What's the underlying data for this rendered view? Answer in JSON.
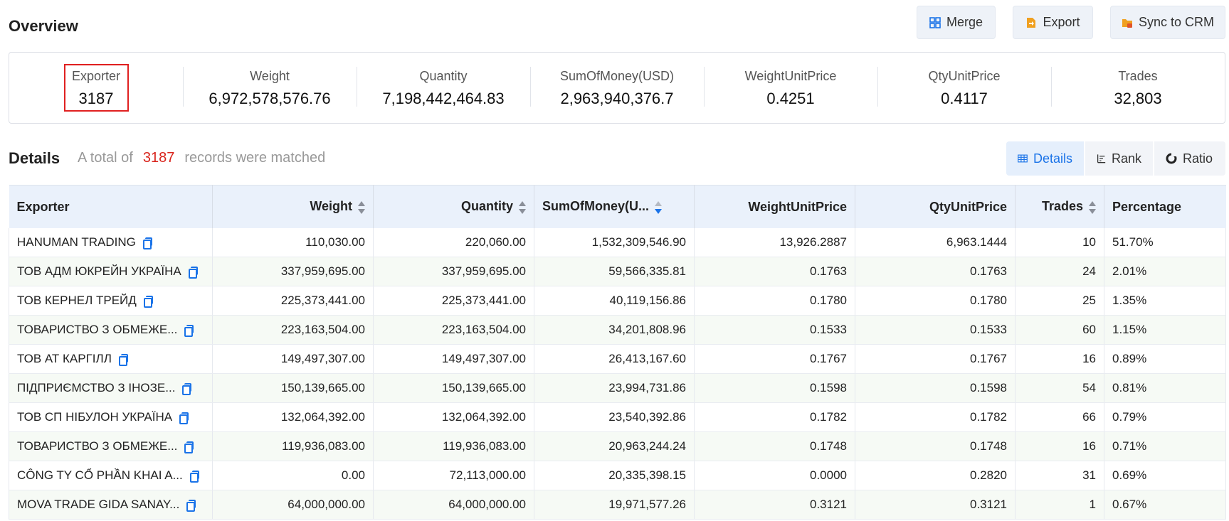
{
  "overview": {
    "title": "Overview",
    "actions": [
      {
        "label": "Merge",
        "icon": "merge-icon"
      },
      {
        "label": "Export",
        "icon": "export-icon"
      },
      {
        "label": "Sync to CRM",
        "icon": "folder-icon"
      }
    ],
    "stats": [
      {
        "label": "Exporter",
        "value": "3187"
      },
      {
        "label": "Weight",
        "value": "6,972,578,576.76"
      },
      {
        "label": "Quantity",
        "value": "7,198,442,464.83"
      },
      {
        "label": "SumOfMoney(USD)",
        "value": "2,963,940,376.7"
      },
      {
        "label": "WeightUnitPrice",
        "value": "0.4251"
      },
      {
        "label": "QtyUnitPrice",
        "value": "0.4117"
      },
      {
        "label": "Trades",
        "value": "32,803"
      }
    ]
  },
  "details": {
    "title": "Details",
    "summary_prefix": "A total of",
    "summary_count": "3187",
    "summary_suffix": "records were matched",
    "views": [
      {
        "label": "Details",
        "icon": "table-icon",
        "active": true
      },
      {
        "label": "Rank",
        "icon": "rank-icon",
        "active": false
      },
      {
        "label": "Ratio",
        "icon": "pie-icon",
        "active": false
      }
    ],
    "columns": [
      "Exporter",
      "Weight",
      "Quantity",
      "SumOfMoney(U...",
      "WeightUnitPrice",
      "QtyUnitPrice",
      "Trades",
      "Percentage"
    ],
    "rows": [
      [
        "HANUMAN TRADING",
        "110,030.00",
        "220,060.00",
        "1,532,309,546.90",
        "13,926.2887",
        "6,963.1444",
        "10",
        "51.70%"
      ],
      [
        "ТОВ АДМ ЮКРЕЙН УКРАЇНА",
        "337,959,695.00",
        "337,959,695.00",
        "59,566,335.81",
        "0.1763",
        "0.1763",
        "24",
        "2.01%"
      ],
      [
        "ТОВ КЕРНЕЛ ТРЕЙД",
        "225,373,441.00",
        "225,373,441.00",
        "40,119,156.86",
        "0.1780",
        "0.1780",
        "25",
        "1.35%"
      ],
      [
        "ТОВАРИСТВО З ОБМЕЖЕ...",
        "223,163,504.00",
        "223,163,504.00",
        "34,201,808.96",
        "0.1533",
        "0.1533",
        "60",
        "1.15%"
      ],
      [
        "ТОВ АТ КАРГІЛЛ",
        "149,497,307.00",
        "149,497,307.00",
        "26,413,167.60",
        "0.1767",
        "0.1767",
        "16",
        "0.89%"
      ],
      [
        "ПІДПРИЄМСТВО З ІНОЗЕ...",
        "150,139,665.00",
        "150,139,665.00",
        "23,994,731.86",
        "0.1598",
        "0.1598",
        "54",
        "0.81%"
      ],
      [
        "ТОВ СП НІБУЛОН УКРАЇНА",
        "132,064,392.00",
        "132,064,392.00",
        "23,540,392.86",
        "0.1782",
        "0.1782",
        "66",
        "0.79%"
      ],
      [
        "ТОВАРИСТВО З ОБМЕЖЕ...",
        "119,936,083.00",
        "119,936,083.00",
        "20,963,244.24",
        "0.1748",
        "0.1748",
        "16",
        "0.71%"
      ],
      [
        "CÔNG TY CỔ PHẦN KHAI A...",
        "0.00",
        "72,113,000.00",
        "20,335,398.15",
        "0.0000",
        "0.2820",
        "31",
        "0.69%"
      ],
      [
        "MOVA TRADE GIDA SANAY...",
        "64,000,000.00",
        "64,000,000.00",
        "19,971,577.26",
        "0.3121",
        "0.3121",
        "1",
        "0.67%"
      ]
    ]
  },
  "colors": {
    "accent": "#1a73e8",
    "highlight": "#e02020",
    "count": "#d9241c",
    "export_icon": "#f0a020"
  }
}
